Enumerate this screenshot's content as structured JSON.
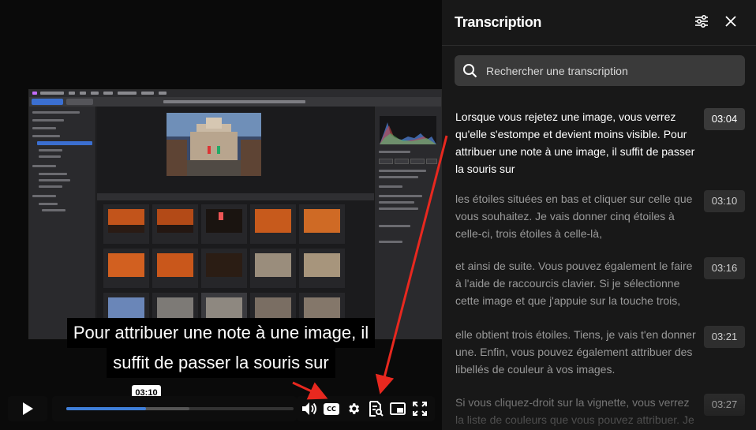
{
  "video": {
    "subtitle_lines": [
      "Pour attribuer une note à une image, il",
      "suffit de passer la souris sur"
    ],
    "current_time_tooltip": "03:10",
    "progress_played": 0.35,
    "progress_buffered": 0.54,
    "cc_label": "CC",
    "accent_color": "#3f7fd9"
  },
  "controls": {
    "icons": [
      "play-icon",
      "volume-icon",
      "cc-icon",
      "settings-icon",
      "transcript-icon",
      "pip-icon",
      "fullscreen-icon"
    ]
  },
  "transcript": {
    "title": "Transcription",
    "search_placeholder": "Rechercher une transcription",
    "segments": [
      {
        "time": "03:04",
        "text": "Lorsque vous rejetez une image, vous verrez qu'elle s'estompe et devient moins visible. Pour attribuer une note à une image, il suffit de passer la souris sur",
        "active": true
      },
      {
        "time": "03:10",
        "text": "les étoiles situées en bas et cliquer sur celle que vous souhaitez. Je vais donner cinq étoiles à celle-ci, trois étoiles à celle-là,",
        "active": false
      },
      {
        "time": "03:16",
        "text": "et ainsi de suite. Vous pouvez également le faire à l'aide de raccourcis clavier. Si je sélectionne cette image et que j'appuie sur la touche trois,",
        "active": false
      },
      {
        "time": "03:21",
        "text": "elle obtient trois étoiles. Tiens, je vais t'en donner une. Enfin, vous pouvez également attribuer des libellés de couleur à vos images.",
        "active": false
      },
      {
        "time": "03:27",
        "text": "Si vous cliquez-droit sur la vignette, vous verrez la liste de couleurs que vous pouvez attribuer. Je",
        "active": false
      }
    ]
  }
}
